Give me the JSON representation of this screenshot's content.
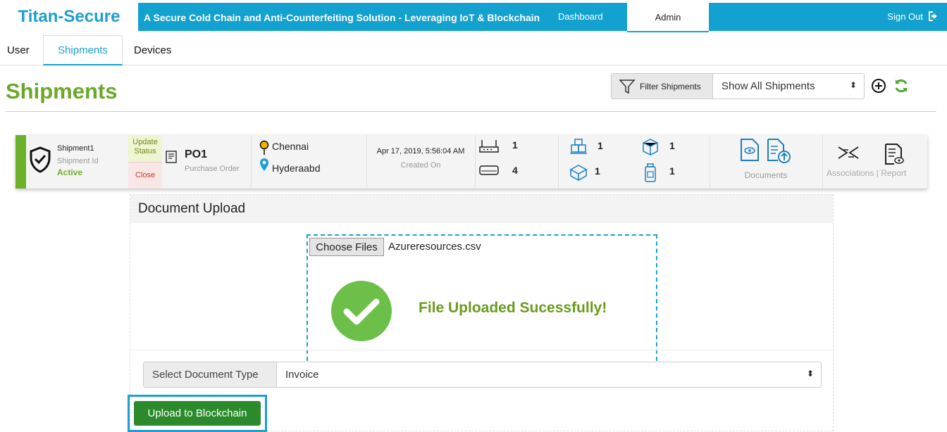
{
  "header": {
    "brand": "Titan-Secure",
    "tagline": "A Secure Cold Chain and Anti-Counterfeiting Solution - Leveraging IoT & Blockchain",
    "nav_dashboard": "Dashboard",
    "nav_admin": "Admin",
    "sign_out": "Sign Out"
  },
  "tabs": {
    "user": "User",
    "shipments": "Shipments",
    "devices": "Devices"
  },
  "page_title": "Shipments",
  "filter": {
    "button_label": "Filter Shipments",
    "selected": "Show All Shipments"
  },
  "shipment": {
    "name": "Shipment1",
    "id_label": "Shipment Id",
    "status": "Active",
    "update_status": "Update Status",
    "close": "Close",
    "po": "PO1",
    "po_label": "Purchase Order",
    "origin": "Chennai",
    "destination": "Hyderaabd",
    "created": "Apr 17, 2019, 5:56:04 AM",
    "created_label": "Created On",
    "counts": {
      "gateway": "1",
      "sensor": "4",
      "pallet": "1",
      "container": "1",
      "package": "1",
      "product": "1"
    },
    "documents_label": "Documents",
    "associations_label": "Associations",
    "report_label": "Report",
    "pipe": "|"
  },
  "upload": {
    "title": "Document Upload",
    "choose_files": "Choose Files",
    "filename": "Azureresources.csv",
    "success_message": "File Uploaded Sucessfully!",
    "doc_type_label": "Select Document Type",
    "doc_type_value": "Invoice",
    "upload_button": "Upload to Blockchain"
  },
  "colors": {
    "brand_blue": "#13a2cf",
    "title_green": "#6aa82a",
    "success_green": "#6cc04a",
    "upload_green": "#2b8a2b"
  }
}
